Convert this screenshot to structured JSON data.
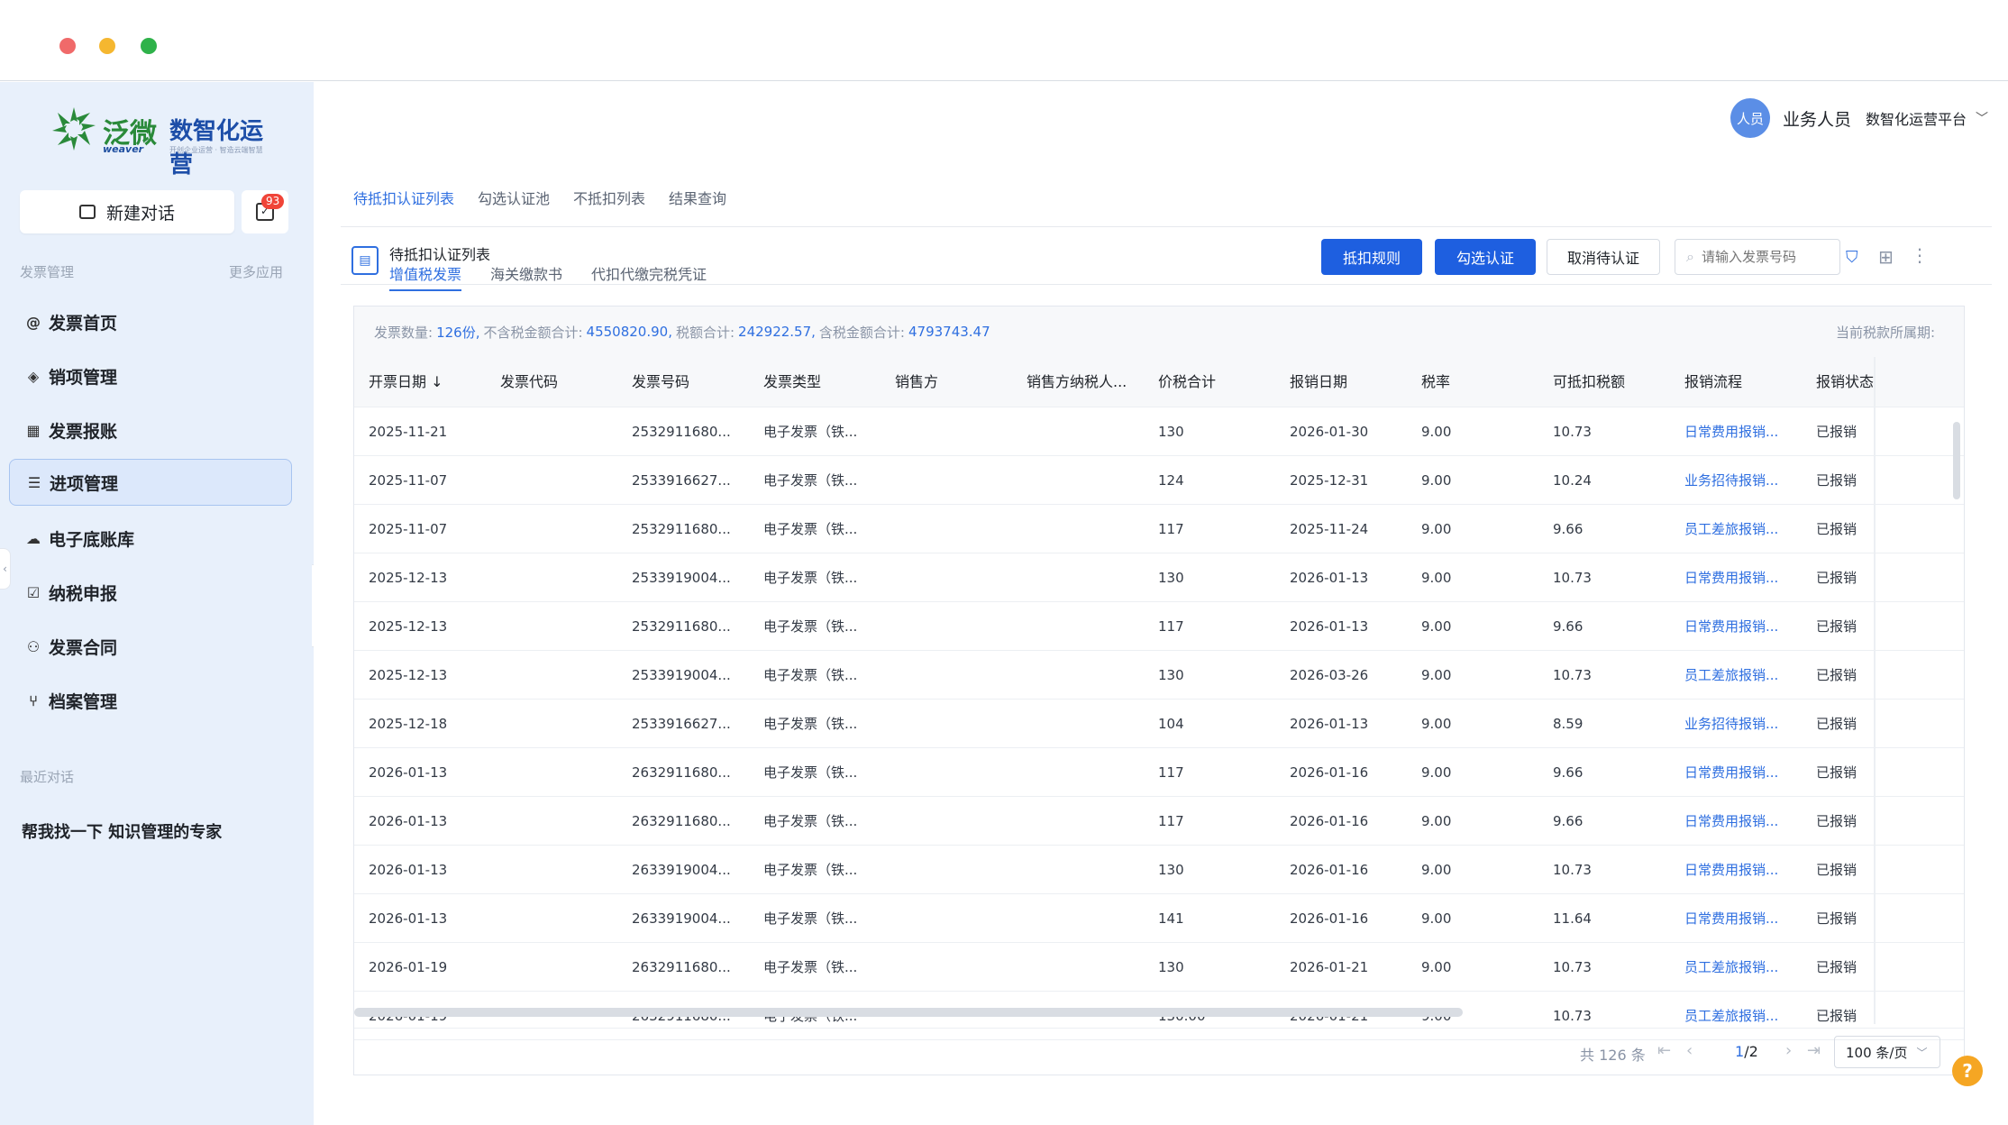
{
  "window": {
    "controls": [
      "close",
      "minimize",
      "maximize"
    ]
  },
  "logo": {
    "text": "泛微",
    "sub": "weaver",
    "brand": "数智化运营",
    "tagline": "开创企业运营 · 智造云端智慧"
  },
  "sidebar": {
    "new_chat": "新建对话",
    "todo_badge": "93",
    "section_label": "发票管理",
    "more_apps": "更多应用",
    "items": [
      {
        "label": "发票首页",
        "icon": "at-icon"
      },
      {
        "label": "销项管理",
        "icon": "layers-icon"
      },
      {
        "label": "发票报账",
        "icon": "table-icon"
      },
      {
        "label": "进项管理",
        "icon": "list-icon",
        "active": true
      },
      {
        "label": "电子底账库",
        "icon": "cloud-icon"
      },
      {
        "label": "纳税申报",
        "icon": "checkbox-icon"
      },
      {
        "label": "发票合同",
        "icon": "people-icon"
      },
      {
        "label": "档案管理",
        "icon": "fork-icon"
      }
    ],
    "recent_label": "最近对话",
    "recent_items": [
      "帮我找一下 知识管理的专家"
    ]
  },
  "header": {
    "avatar": "人员",
    "user_name": "业务人员",
    "platform": "数智化运营平台"
  },
  "tabs": [
    "待抵扣认证列表",
    "勾选认证池",
    "不抵扣列表",
    "结果查询"
  ],
  "subhead": {
    "title": "待抵扣认证列表",
    "tabs": [
      "增值税发票",
      "海关缴款书",
      "代扣代缴完税凭证"
    ],
    "btn_rules": "抵扣规则",
    "btn_select": "勾选认证",
    "btn_cancel": "取消待认证",
    "search_placeholder": "请输入发票号码"
  },
  "summary": {
    "count_label": "发票数量:",
    "count": "126份,",
    "untaxed_label": "不含税金额合计:",
    "untaxed": "4550820.90,",
    "tax_label": "税额合计:",
    "tax": "242922.57,",
    "taxed_label": "含税金额合计:",
    "taxed": "4793743.47",
    "period_label": "当前税款所属期:"
  },
  "table": {
    "headers": [
      "开票日期 ↓",
      "发票代码",
      "发票号码",
      "发票类型",
      "销售方",
      "销售方纳税人...",
      "价税合计",
      "报销日期",
      "税率",
      "可抵扣税额",
      "报销流程",
      "报销状态"
    ],
    "rows": [
      [
        "2025-11-21",
        "",
        "2532911680...",
        "电子发票（铁...",
        "",
        "",
        "130",
        "2026-01-30",
        "9.00",
        "10.73",
        "日常费用报销...",
        "已报销"
      ],
      [
        "2025-11-07",
        "",
        "2533916627...",
        "电子发票（铁...",
        "",
        "",
        "124",
        "2025-12-31",
        "9.00",
        "10.24",
        "业务招待报销...",
        "已报销"
      ],
      [
        "2025-11-07",
        "",
        "2532911680...",
        "电子发票（铁...",
        "",
        "",
        "117",
        "2025-11-24",
        "9.00",
        "9.66",
        "员工差旅报销...",
        "已报销"
      ],
      [
        "2025-12-13",
        "",
        "2533919004...",
        "电子发票（铁...",
        "",
        "",
        "130",
        "2026-01-13",
        "9.00",
        "10.73",
        "日常费用报销...",
        "已报销"
      ],
      [
        "2025-12-13",
        "",
        "2532911680...",
        "电子发票（铁...",
        "",
        "",
        "117",
        "2026-01-13",
        "9.00",
        "9.66",
        "日常费用报销...",
        "已报销"
      ],
      [
        "2025-12-13",
        "",
        "2533919004...",
        "电子发票（铁...",
        "",
        "",
        "130",
        "2026-03-26",
        "9.00",
        "10.73",
        "员工差旅报销...",
        "已报销"
      ],
      [
        "2025-12-18",
        "",
        "2533916627...",
        "电子发票（铁...",
        "",
        "",
        "104",
        "2026-01-13",
        "9.00",
        "8.59",
        "业务招待报销...",
        "已报销"
      ],
      [
        "2026-01-13",
        "",
        "2632911680...",
        "电子发票（铁...",
        "",
        "",
        "117",
        "2026-01-16",
        "9.00",
        "9.66",
        "日常费用报销...",
        "已报销"
      ],
      [
        "2026-01-13",
        "",
        "2632911680...",
        "电子发票（铁...",
        "",
        "",
        "117",
        "2026-01-16",
        "9.00",
        "9.66",
        "日常费用报销...",
        "已报销"
      ],
      [
        "2026-01-13",
        "",
        "2633919004...",
        "电子发票（铁...",
        "",
        "",
        "130",
        "2026-01-16",
        "9.00",
        "10.73",
        "日常费用报销...",
        "已报销"
      ],
      [
        "2026-01-13",
        "",
        "2633919004...",
        "电子发票（铁...",
        "",
        "",
        "141",
        "2026-01-16",
        "9.00",
        "11.64",
        "日常费用报销...",
        "已报销"
      ],
      [
        "2026-01-19",
        "",
        "2632911680...",
        "电子发票（铁...",
        "",
        "",
        "130",
        "2026-01-21",
        "9.00",
        "10.73",
        "员工差旅报销...",
        "已报销"
      ],
      [
        "2026-01-19",
        "",
        "2632911680...",
        "电子发票（铁...",
        "",
        "",
        "130.00",
        "2026-01-21",
        "9.00",
        "10.73",
        "员工差旅报销...",
        "已报销"
      ]
    ]
  },
  "pager": {
    "total": "共 126 条",
    "current": "1",
    "pages": "/2",
    "page_size": "100 条/页"
  },
  "colors": {
    "accent": "#2f6fe0",
    "primary_button": "#1e5fe0",
    "sidebar_bg": "#e8f0fb",
    "help": "#f5a623"
  }
}
